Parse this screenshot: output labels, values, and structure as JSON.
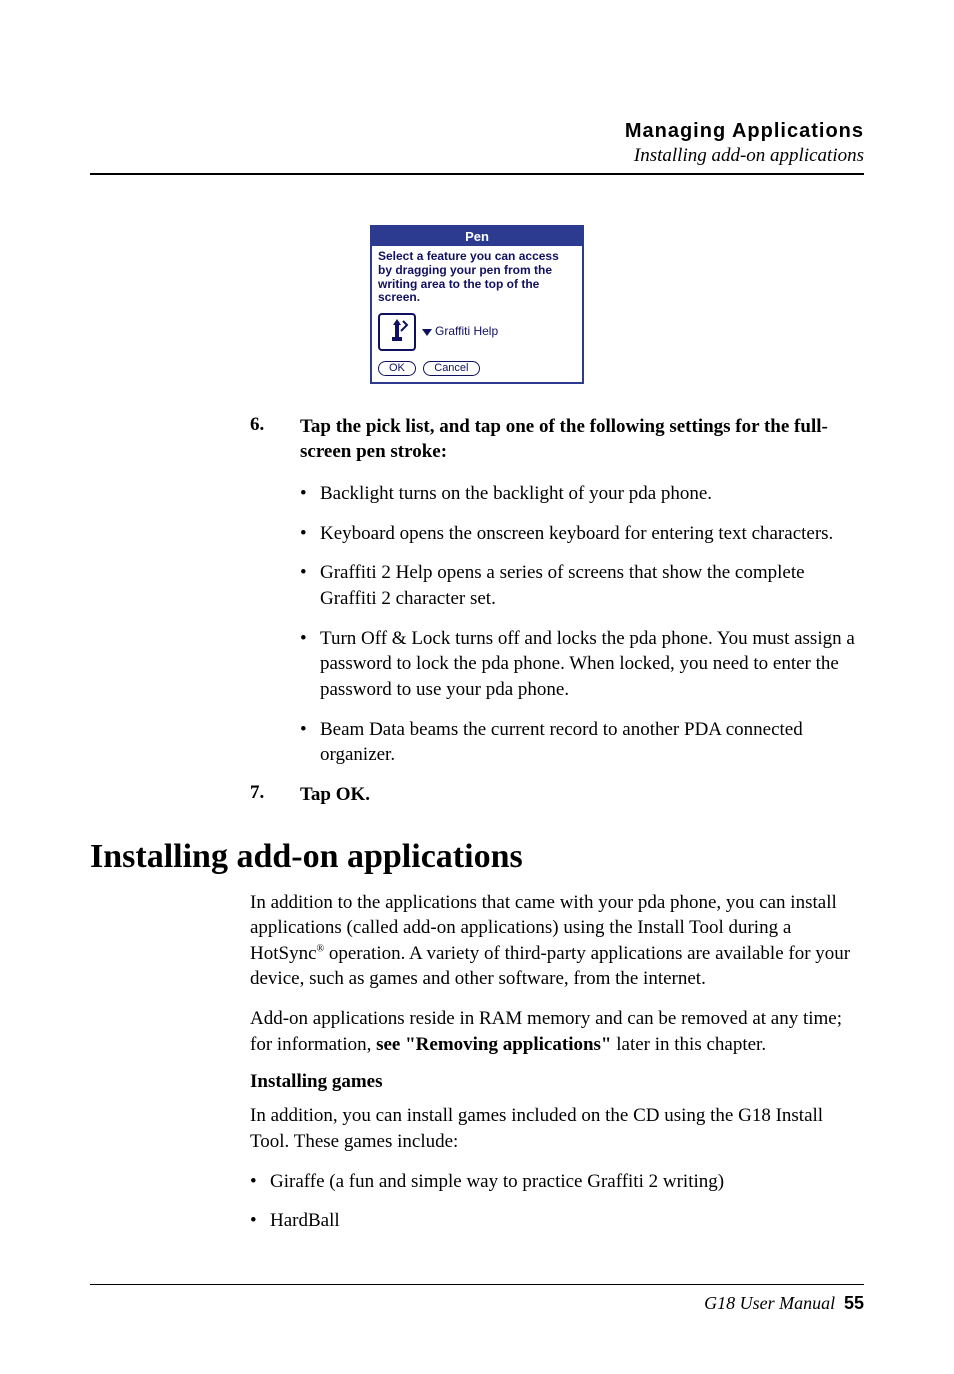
{
  "header": {
    "title": "Managing Applications",
    "subtitle": "Installing add-on applications"
  },
  "palm": {
    "title": "Pen",
    "instruction": "Select a feature you can access by dragging your pen from the writing area to the top of the screen.",
    "dropdown": "Graffiti Help",
    "ok": "OK",
    "cancel": "Cancel"
  },
  "steps": {
    "s6num": "6.",
    "s6text": "Tap the pick list, and tap one of the following settings for the full-screen pen stroke:",
    "bullets": [
      "Backlight turns on the backlight of your pda phone.",
      "Keyboard opens the onscreen keyboard for entering text characters.",
      "Graffiti 2 Help opens a series of screens that show the complete Graffiti 2 character set.",
      "Turn Off & Lock turns off and locks the pda phone. You must assign a password to lock the pda phone. When locked, you need to enter the password to use your pda phone.",
      "Beam Data beams the current record to another PDA connected organizer."
    ],
    "s7num": "7.",
    "s7text": "Tap OK."
  },
  "section": {
    "heading": "Installing add-on applications",
    "para1a": "In addition to the applications that came with your pda phone, you can install applications (called add-on applications) using the Install Tool during a HotSync",
    "para1b": " operation. A variety of third-party applications are available for your device, such as games and other software, from the internet.",
    "para2a": "Add-on applications reside in RAM memory and can be removed at any time; for information, ",
    "para2b": "see \"Removing applications\"",
    "para2c": " later in this chapter.",
    "subheading": "Installing games",
    "para3": "In addition, you can install games included on the CD using the G18 Install Tool. These games include:",
    "games": [
      "Giraffe (a fun and simple way to practice Graffiti 2 writing)",
      "HardBall"
    ]
  },
  "footer": {
    "manual": "G18 User Manual",
    "page": "55"
  }
}
